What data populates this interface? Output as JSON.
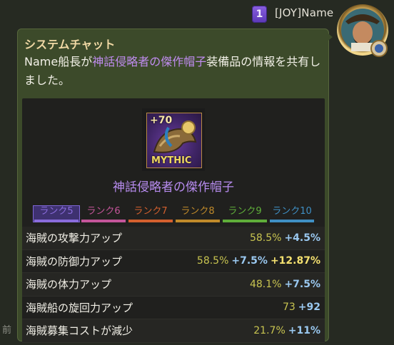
{
  "sidebar": {
    "truncated_label": "前"
  },
  "header": {
    "rank_number": "1",
    "sender": "[JOY]Name"
  },
  "message": {
    "title": "システムチャット",
    "text_before": "Name船長が",
    "item_link": "神話侵略者の傑作帽子",
    "text_after": "装備品の情報を共有しました。"
  },
  "item": {
    "enhancement": "+70",
    "rarity": "MYTHIC",
    "name": "神話侵略者の傑作帽子"
  },
  "ranks": [
    {
      "label": "ランク5",
      "color": "#8a6cdc",
      "selected": true
    },
    {
      "label": "ランク6",
      "color": "#c4559a",
      "selected": false
    },
    {
      "label": "ランク7",
      "color": "#d4602e",
      "selected": false
    },
    {
      "label": "ランク8",
      "color": "#c08a2a",
      "selected": false
    },
    {
      "label": "ランク9",
      "color": "#5fae3a",
      "selected": false
    },
    {
      "label": "ランク10",
      "color": "#3f8fc4",
      "selected": false
    }
  ],
  "stats": [
    {
      "label": "海賊の攻撃力アップ",
      "base": "58.5%",
      "plus": "+4.5%",
      "extra": ""
    },
    {
      "label": "海賊の防御力アップ",
      "base": "58.5%",
      "plus": "+7.5%",
      "extra": "+12.87%"
    },
    {
      "label": "海賊の体力アップ",
      "base": "48.1%",
      "plus": "+7.5%",
      "extra": ""
    },
    {
      "label": "海賊船の旋回力アップ",
      "base": "73",
      "plus": "+92",
      "extra": ""
    },
    {
      "label": "海賊募集コストが減少",
      "base": "21.7%",
      "plus": "+11%",
      "extra": ""
    }
  ]
}
